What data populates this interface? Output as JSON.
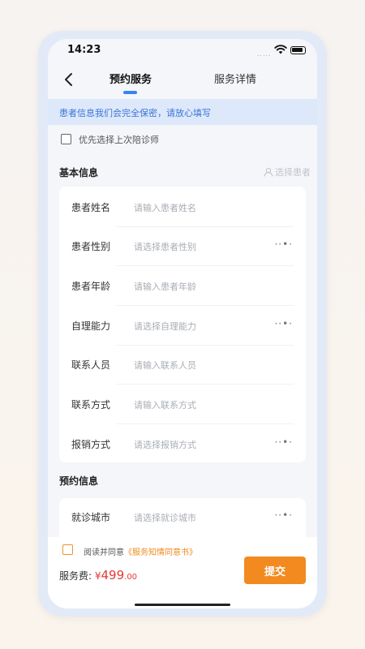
{
  "status_bar": {
    "time": "14:23",
    "signal": "....."
  },
  "nav": {
    "tabs": [
      {
        "label": "预约服务",
        "active": true
      },
      {
        "label": "服务详情",
        "active": false
      }
    ]
  },
  "notice": "患者信息我们会完全保密，请放心填写",
  "prefer_last": "优先选择上次陪诊师",
  "basic_info": {
    "title": "基本信息",
    "choose_patient": "选择患者",
    "fields": [
      {
        "label": "患者姓名",
        "placeholder": "请输入患者姓名",
        "more": ""
      },
      {
        "label": "患者性别",
        "placeholder": "请选择患者性别",
        "more": "··•·"
      },
      {
        "label": "患者年龄",
        "placeholder": "请输入患者年龄",
        "more": ""
      },
      {
        "label": "自理能力",
        "placeholder": "请选择自理能力",
        "more": "··•·"
      },
      {
        "label": "联系人员",
        "placeholder": "请输入联系人员",
        "more": ""
      },
      {
        "label": "联系方式",
        "placeholder": "请输入联系方式",
        "more": ""
      },
      {
        "label": "报销方式",
        "placeholder": "请选择报销方式",
        "more": "··•·"
      }
    ]
  },
  "appointment_info": {
    "title": "预约信息",
    "fields": [
      {
        "label": "就诊城市",
        "placeholder": "请选择就诊城市",
        "more": "··•·"
      }
    ]
  },
  "footer": {
    "agree_prefix": "阅读并同意",
    "agree_link": "《服务知情同意书》",
    "fee_label": "服务费: ",
    "currency": "¥",
    "price_int": "499",
    "price_dec": ".00",
    "submit_label": "提交"
  },
  "colors": {
    "accent_blue": "#3b82f6",
    "accent_orange": "#f28a1f",
    "price_red": "#e53935"
  }
}
